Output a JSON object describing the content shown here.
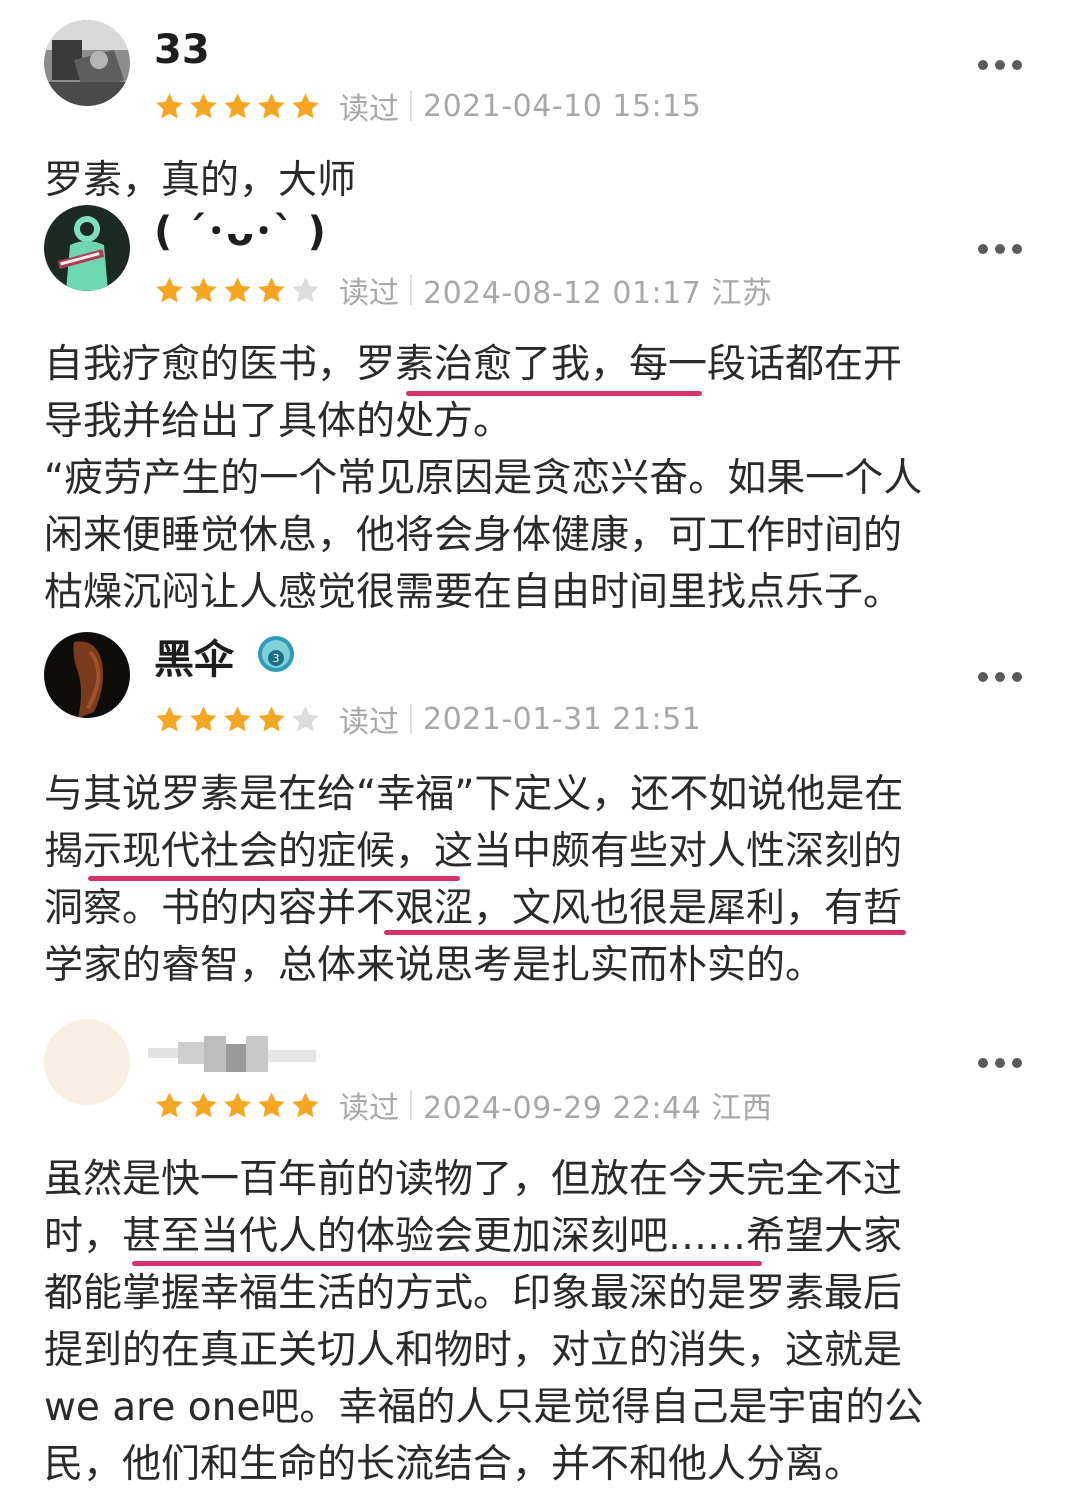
{
  "colors": {
    "star_filled": "#f5a623",
    "star_empty": "#dcdcdc",
    "highlight": "#d6336c",
    "meta_text": "#a8a8a8"
  },
  "reviews": [
    {
      "username": "33",
      "rating": 5,
      "status": "读过",
      "date": "2021-04-10 15:15",
      "text": "罗素，真的，大师"
    },
    {
      "username": "( ´･ᴗ･` )",
      "rating": 4,
      "status": "读过",
      "date": "2024-08-12 01:17 江苏",
      "text": "自我疗愈的医书，罗素治愈了我，每一段话都在开\n导我并给出了具体的处方。\n“疲劳产生的一个常见原因是贪恋兴奋。如果一个人\n闲来便睡觉休息，他将会身体健康，可工作时间的\n枯燥沉闷让人感觉很需要在自由时间里找点乐子。"
    },
    {
      "username": "黑伞",
      "badge": "3",
      "rating": 4,
      "status": "读过",
      "date": "2021-01-31 21:51",
      "text": "与其说罗素是在给“幸福”下定义，还不如说他是在\n揭示现代社会的症候，这当中颇有些对人性深刻的\n洞察。书的内容并不艰涩，文风也很是犀利，有哲\n学家的睿智，总体来说思考是扎实而朴实的。"
    },
    {
      "rating": 5,
      "status": "读过",
      "date": "2024-09-29 22:44 江西",
      "text": "虽然是快一百年前的读物了，但放在今天完全不过\n时，甚至当代人的体验会更加深刻吧……希望大家\n都能掌握幸福生活的方式。印象最深的是罗素最后\n提到的在真正关切人和物时，对立的消失，这就是\nwe are one吧。幸福的人只是觉得自己是宇宙的公\n民，他们和生命的长流结合，并不和他人分离。"
    }
  ]
}
